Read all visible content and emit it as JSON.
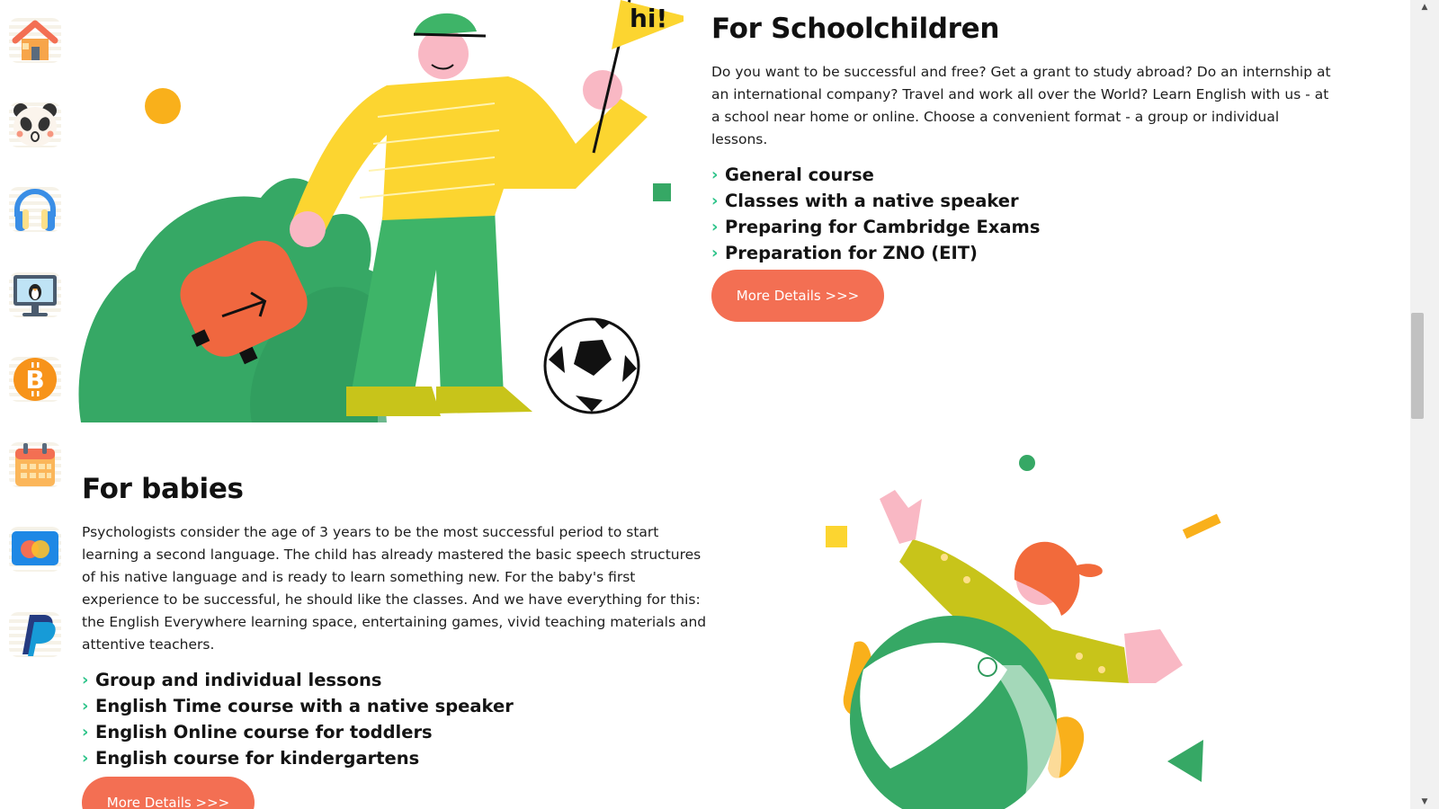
{
  "sidebar": {
    "items": [
      {
        "icon": "home-icon",
        "color": "#f5894b"
      },
      {
        "icon": "panda-icon",
        "color": "#333333"
      },
      {
        "icon": "headphones-icon",
        "color": "#3a8ee6"
      },
      {
        "icon": "monitor-penguin-icon",
        "color": "#4a5b6e"
      },
      {
        "icon": "bitcoin-icon",
        "color": "#f7931a"
      },
      {
        "icon": "calendar-icon",
        "color": "#f36f53"
      },
      {
        "icon": "mastercard-icon",
        "color": "#1e88e5"
      },
      {
        "icon": "paypal-icon",
        "color": "#179bd7"
      }
    ]
  },
  "schoolchildren": {
    "title": "For Schoolchildren",
    "description": "Do you want to be successful and free? Get a grant to study abroad? Do an internship at an international company? Travel and work all over the World? Learn English with us - at a school near home or online. Choose a convenient format - a group or individual lessons.",
    "features": [
      "General course",
      "Classes with a native speaker",
      "Preparing for Cambridge Exams",
      "Preparation for ZNO (EIT)"
    ],
    "button_label": "More Details >>>",
    "illustration_sign": "hi!"
  },
  "babies": {
    "title": "For babies",
    "description": "Psychologists consider the age of 3 years to be the most successful period to start learning a second language. The child has already mastered the basic speech structures of his native language and is ready to learn something new. For the baby's first experience to be successful, he should like the classes. And we have everything for this: the English Everywhere learning space, entertaining games, vivid teaching materials and attentive teachers.",
    "features": [
      "Group and individual lessons",
      "English Time course with a native speaker",
      "English Online course for toddlers",
      "English course for kindergartens"
    ],
    "button_label": "More Details >>>"
  },
  "colors": {
    "accent_button": "#f36f53",
    "chevron": "#2ec48a",
    "text": "#1d1d1d"
  }
}
